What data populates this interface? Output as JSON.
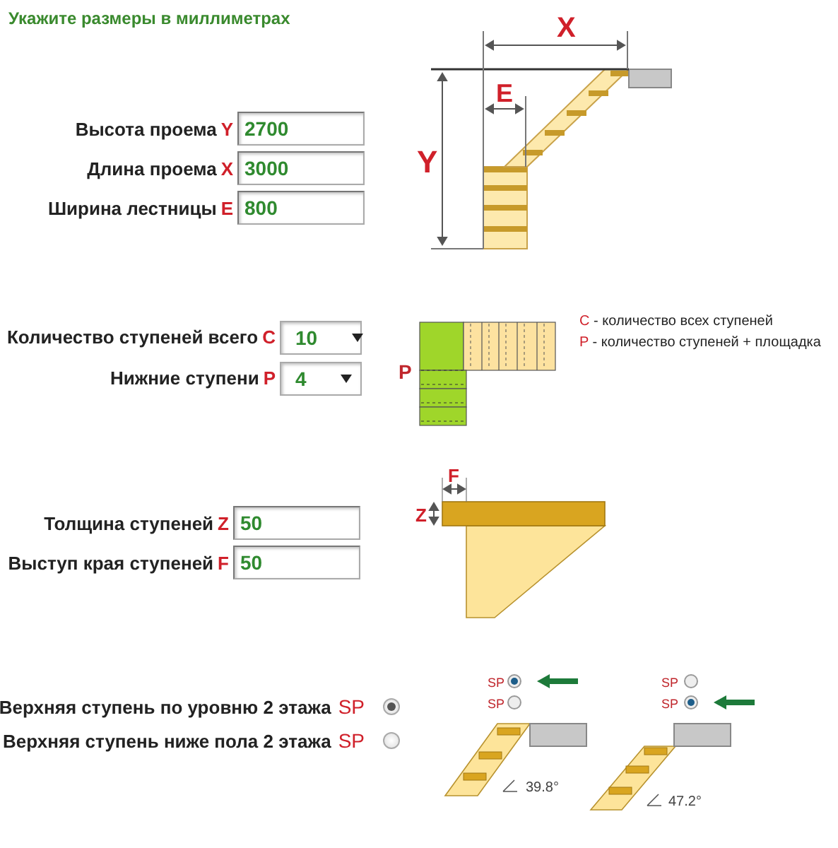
{
  "heading": "Укажите размеры в миллиметрах",
  "dimensions": {
    "fields": [
      {
        "label": "Высота проема",
        "letter": "Y",
        "value": "2700"
      },
      {
        "label": "Длина проема",
        "letter": "X",
        "value": "3000"
      },
      {
        "label": "Ширина лестницы",
        "letter": "E",
        "value": "800"
      }
    ],
    "diagram_labels": {
      "length": "X",
      "width": "E",
      "height": "Y"
    }
  },
  "steps": {
    "fields": [
      {
        "label": "Количество ступеней всего",
        "letter": "C",
        "value": "10"
      },
      {
        "label": "Нижние ступени",
        "letter": "P",
        "value": "4"
      }
    ],
    "diagram_label": "P",
    "legend": [
      {
        "letter": "C",
        "text": " - количество всех ступеней"
      },
      {
        "letter": "P",
        "text": " - количество ступеней + площадка"
      }
    ]
  },
  "tread": {
    "fields": [
      {
        "label": "Толщина ступеней",
        "letter": "Z",
        "value": "50"
      },
      {
        "label": "Выступ края ступеней",
        "letter": "F",
        "value": "50"
      }
    ],
    "diagram_labels": {
      "overhang": "F",
      "thickness": "Z"
    }
  },
  "top_step": {
    "options": [
      {
        "label": "Верхняя ступень по уровню 2 этажа",
        "letter": "SP",
        "selected": true
      },
      {
        "label": "Верхняя ступень ниже пола 2 этажа",
        "letter": "SP",
        "selected": false
      }
    ],
    "examples": [
      {
        "options": [
          {
            "letter": "SP",
            "selected": true
          },
          {
            "letter": "SP",
            "selected": false
          }
        ],
        "angle": "39.8°"
      },
      {
        "options": [
          {
            "letter": "SP",
            "selected": false
          },
          {
            "letter": "SP",
            "selected": true
          }
        ],
        "angle": "47.2°"
      }
    ]
  }
}
